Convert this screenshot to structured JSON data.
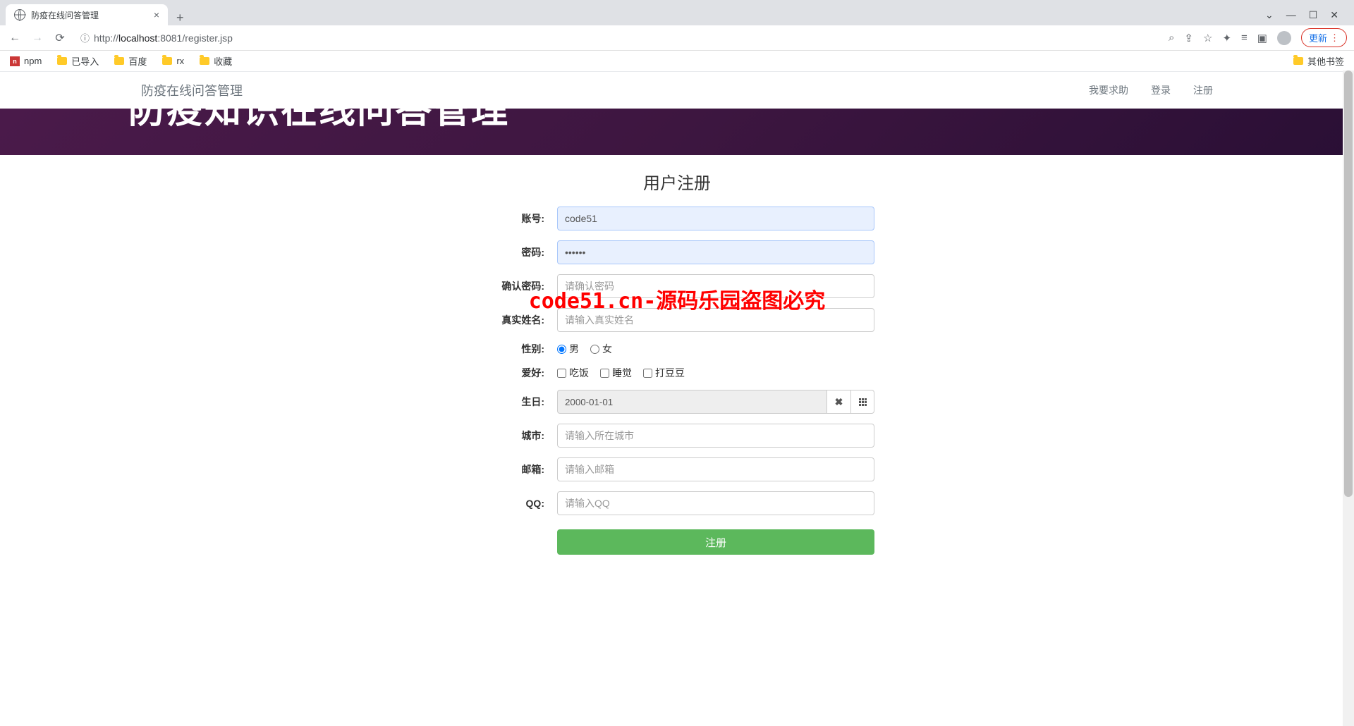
{
  "browser": {
    "tab_title": "防疫在线问答管理",
    "url_info": "http://",
    "url_host": "localhost",
    "url_port": ":8081",
    "url_path": "/register.jsp",
    "update_label": "更新"
  },
  "bookmarks": {
    "npm": "npm",
    "imported": "已导入",
    "baidu": "百度",
    "rx": "rx",
    "favorites": "收藏",
    "other": "其他书签"
  },
  "nav": {
    "brand": "防疫在线问答管理",
    "help": "我要求助",
    "login": "登录",
    "register": "注册"
  },
  "banner": {
    "partial_title": "防疫知识在线问答管理"
  },
  "form": {
    "title": "用户注册",
    "account_label": "账号:",
    "account_value": "code51",
    "password_label": "密码:",
    "password_value": "••••••",
    "confirm_label": "确认密码:",
    "confirm_placeholder": "请确认密码",
    "realname_label": "真实姓名:",
    "realname_placeholder": "请输入真实姓名",
    "gender_label": "性别:",
    "gender_male": "男",
    "gender_female": "女",
    "hobby_label": "爱好:",
    "hobby_eat": "吃饭",
    "hobby_sleep": "睡觉",
    "hobby_play": "打豆豆",
    "birthday_label": "生日:",
    "birthday_value": "2000-01-01",
    "city_label": "城市:",
    "city_placeholder": "请输入所在城市",
    "email_label": "邮箱:",
    "email_placeholder": "请输入邮箱",
    "qq_label": "QQ:",
    "qq_placeholder": "请输入QQ",
    "submit_label": "注册"
  },
  "watermark": "code51.cn-源码乐园盗图必究"
}
